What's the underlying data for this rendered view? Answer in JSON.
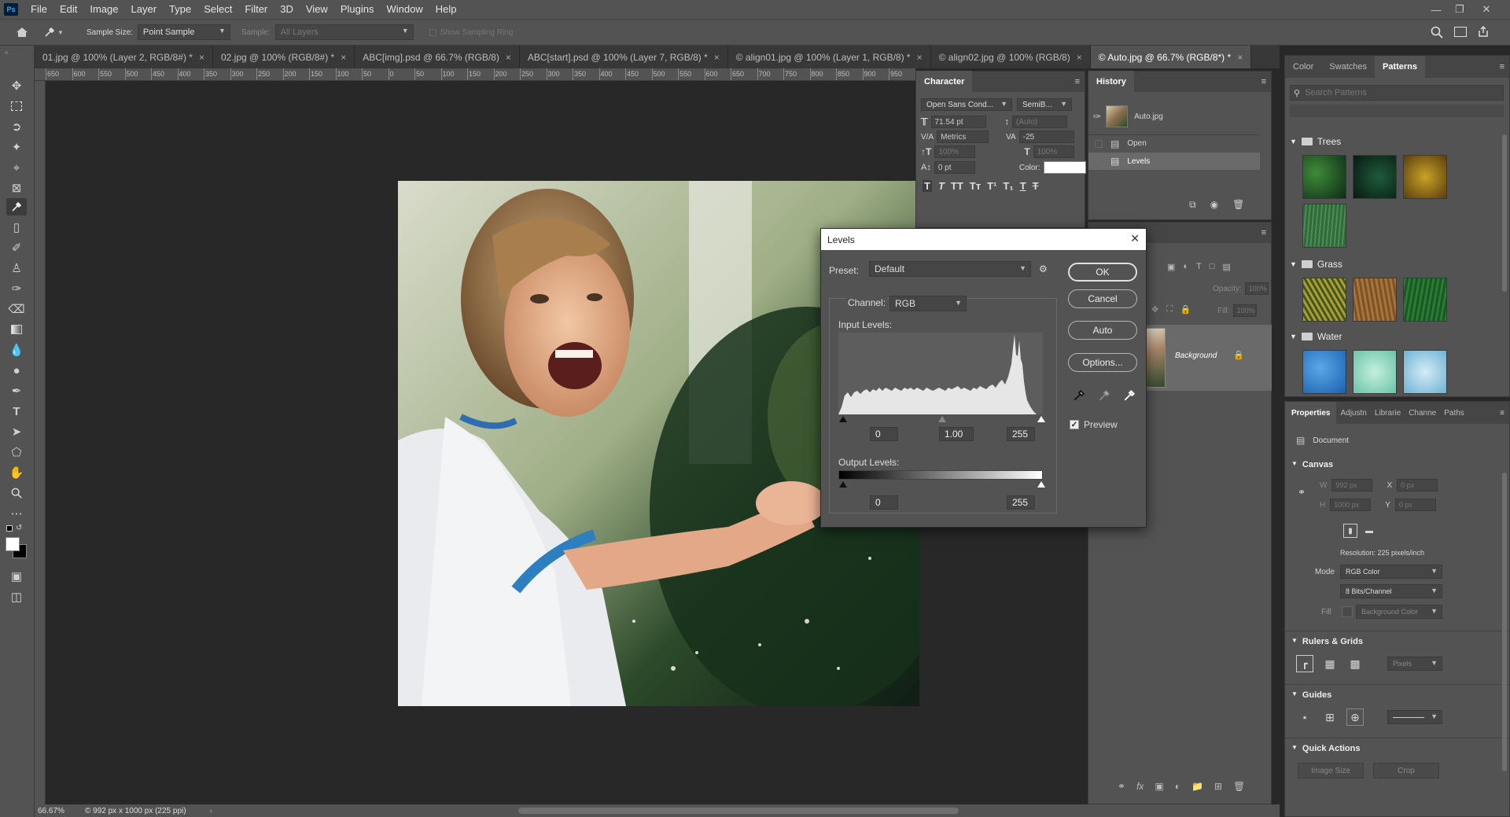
{
  "menu": {
    "items": [
      "File",
      "Edit",
      "Image",
      "Layer",
      "Type",
      "Select",
      "Filter",
      "3D",
      "View",
      "Plugins",
      "Window",
      "Help"
    ],
    "logo": "Ps"
  },
  "options": {
    "sample_size_label": "Sample Size:",
    "sample_size_value": "Point Sample",
    "sample_label": "Sample:",
    "sample_value": "All Layers",
    "show_ring_label": "Show Sampling Ring"
  },
  "tabs": [
    {
      "label": "01.jpg @ 100% (Layer 2, RGB/8#) *"
    },
    {
      "label": "02.jpg @ 100% (RGB/8#) *"
    },
    {
      "label": "ABC[img].psd @ 66.7% (RGB/8)"
    },
    {
      "label": "ABC[start].psd @ 100% (Layer 7, RGB/8) *"
    },
    {
      "label": "© align01.jpg @ 100% (Layer 1, RGB/8) *"
    },
    {
      "label": "© align02.jpg @ 100% (RGB/8)"
    },
    {
      "label": "© Auto.jpg @ 66.7% (RGB/8*) *"
    }
  ],
  "ruler_ticks": [
    "650",
    "600",
    "550",
    "500",
    "450",
    "400",
    "350",
    "300",
    "250",
    "200",
    "150",
    "100",
    "50",
    "0",
    "50",
    "100",
    "150",
    "200",
    "250",
    "300",
    "350",
    "400",
    "450",
    "500",
    "550",
    "600",
    "650",
    "700",
    "750",
    "800",
    "850",
    "900",
    "950"
  ],
  "status": {
    "zoom": "66.67%",
    "doc_info": "© 992 px x 1000 px (225 ppi)"
  },
  "character": {
    "tab": "Character",
    "font": "Open Sans Cond...",
    "style": "SemiB...",
    "size": "71.54 pt",
    "leading": "(Auto)",
    "kerning": "Metrics",
    "tracking": "-25",
    "vscale": "100%",
    "hscale": "100%",
    "baseline": "0 pt",
    "color_label": "Color:"
  },
  "history": {
    "tab": "History",
    "snapshot": "Auto.jpg",
    "items": [
      "Open",
      "Levels"
    ]
  },
  "layers": {
    "opacity_label": "Opacity:",
    "opacity_value": "100%",
    "fill_label": "Fill:",
    "fill_value": "100%",
    "layer_name": "Background"
  },
  "patterns_panel": {
    "tabs": [
      "Color",
      "Swatches",
      "Patterns"
    ],
    "search_placeholder": "Search Patterns",
    "groups": [
      "Trees",
      "Grass",
      "Water"
    ]
  },
  "properties": {
    "tabs": [
      "Properties",
      "Adjustn",
      "Librarie",
      "Channe",
      "Paths"
    ],
    "document_label": "Document",
    "canvas_heading": "Canvas",
    "w_label": "W",
    "w_value": "992 px",
    "h_label": "H",
    "h_value": "1000 px",
    "x_label": "X",
    "x_value": "0 px",
    "y_label": "Y",
    "y_value": "0 px",
    "resolution": "Resolution: 225 pixels/inch",
    "mode_label": "Mode",
    "mode_value": "RGB Color",
    "depth_value": "8 Bits/Channel",
    "fill_label": "Fill",
    "fill_value": "Background Color",
    "rulers_heading": "Rulers & Grids",
    "units_value": "Pixels",
    "guides_heading": "Guides",
    "quick_heading": "Quick Actions",
    "image_size_button": "Image Size",
    "crop_button": "Crop"
  },
  "levels": {
    "title": "Levels",
    "preset_label": "Preset:",
    "preset_value": "Default",
    "channel_label": "Channel:",
    "channel_value": "RGB",
    "input_label": "Input Levels:",
    "input_black": "0",
    "input_gamma": "1.00",
    "input_white": "255",
    "output_label": "Output Levels:",
    "output_black": "0",
    "output_white": "255",
    "ok": "OK",
    "cancel": "Cancel",
    "auto": "Auto",
    "options": "Options...",
    "preview_label": "Preview",
    "preview_checked": true
  }
}
